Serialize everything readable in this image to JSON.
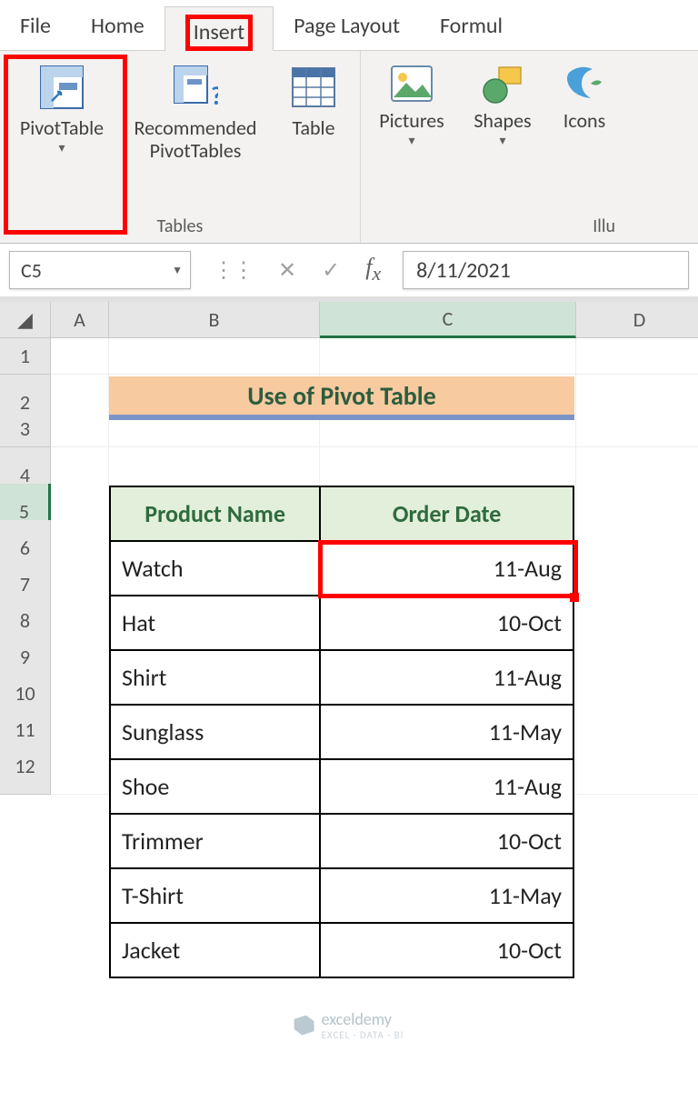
{
  "ribbon": {
    "tabs": {
      "file": "File",
      "home": "Home",
      "insert": "Insert",
      "page_layout": "Page Layout",
      "formulas": "Formul"
    },
    "active_tab": "Insert",
    "groups": {
      "tables": {
        "label": "Tables",
        "pivot_table": "PivotTable",
        "recommended_pivot": "Recommended\nPivotTables",
        "table": "Table"
      },
      "illustrations": {
        "label": "Illu",
        "pictures": "Pictures",
        "shapes": "Shapes",
        "icons": "Icons"
      }
    }
  },
  "namebox": {
    "value": "C5"
  },
  "formula_bar": {
    "value": "8/11/2021"
  },
  "columns": [
    "A",
    "B",
    "C",
    "D"
  ],
  "rows": [
    "1",
    "2",
    "3",
    "4",
    "5",
    "6",
    "7",
    "8",
    "9",
    "10",
    "11",
    "12"
  ],
  "selected_cell": "C5",
  "title": "Use of Pivot Table",
  "table": {
    "headers": {
      "product": "Product Name",
      "date": "Order Date"
    },
    "rows": [
      {
        "product": "Watch",
        "date": "11-Aug"
      },
      {
        "product": "Hat",
        "date": "10-Oct"
      },
      {
        "product": "Shirt",
        "date": "11-Aug"
      },
      {
        "product": "Sunglass",
        "date": "11-May"
      },
      {
        "product": "Shoe",
        "date": "11-Aug"
      },
      {
        "product": "Trimmer",
        "date": "10-Oct"
      },
      {
        "product": "T-Shirt",
        "date": "11-May"
      },
      {
        "product": "Jacket",
        "date": "10-Oct"
      }
    ]
  },
  "watermark": {
    "brand": "exceldemy",
    "tag": "EXCEL · DATA · BI"
  }
}
